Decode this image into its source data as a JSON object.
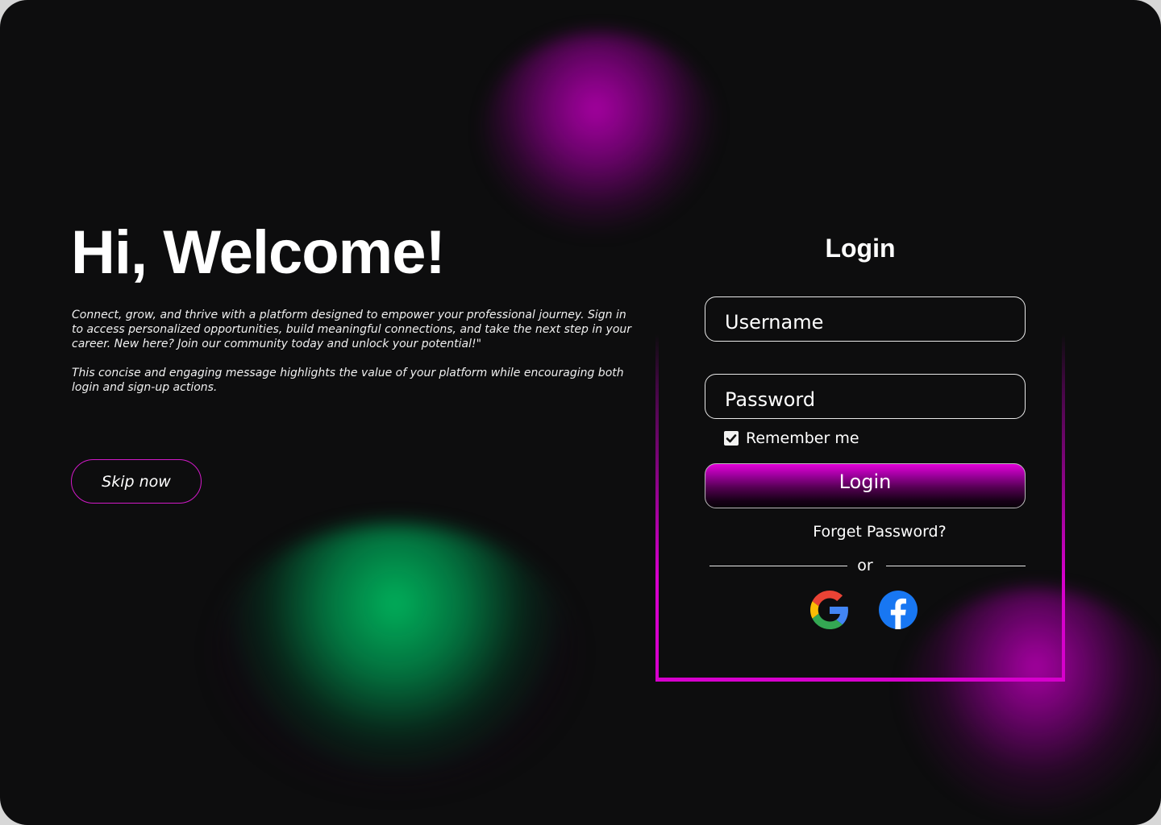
{
  "hero": {
    "title": "Hi, Welcome!",
    "paragraph_1": "Connect, grow, and thrive with a platform designed to empower your professional journey. Sign in to access personalized opportunities, build meaningful connections, and take the next step in your career. New here? Join our community today and unlock your potential!\"",
    "paragraph_2": "This concise and engaging message highlights the value of your platform while encouraging both login and sign-up actions.",
    "skip_label": "Skip now"
  },
  "login": {
    "title": "Login",
    "username_placeholder": "Username",
    "password_placeholder": "Password",
    "remember_label": "Remember me",
    "remember_checked": true,
    "submit_label": "Login",
    "forgot_label": "Forget Password?",
    "divider_label": "or",
    "social": [
      {
        "icon": "google-icon"
      },
      {
        "icon": "facebook-icon"
      }
    ]
  },
  "colors": {
    "background": "#0d0d0e",
    "accent_magenta": "#d600cc",
    "accent_green": "#00b95f",
    "text": "#ffffff"
  }
}
